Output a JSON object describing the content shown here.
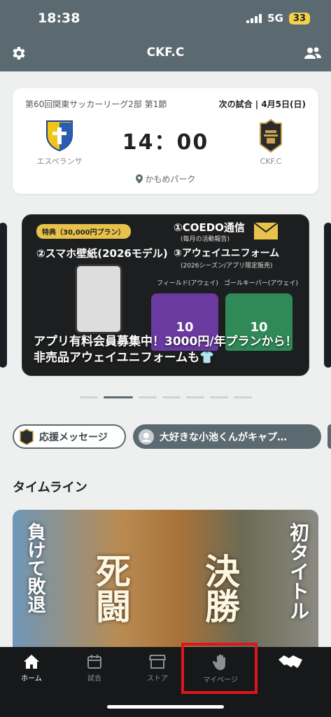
{
  "status_bar": {
    "time": "18:38",
    "network": "5G",
    "battery": "33"
  },
  "header": {
    "title": "CKF.C",
    "left_icon": "gear-icon",
    "right_icon": "people-icon"
  },
  "match": {
    "league": "第60回関東サッカーリーグ2部 第1節",
    "next_match": "次の試合 | 4月5日(日)",
    "home_team": "エスペランサ",
    "away_team": "CKF.C",
    "kickoff": "14：00",
    "venue": "かもめパーク"
  },
  "banner": {
    "tag": "特典（30,000円プラン）",
    "item1": "①COEDO通信",
    "item1_sub": "(毎月の活動報告)",
    "item2": "②スマホ壁紙(2026モデル)",
    "item3": "③アウェイユニフォーム",
    "item3_sub": "(2026シーズン/アプリ限定販売)",
    "field_label": "フィールド(アウェイ)",
    "gk_label": "ゴールキーパー(アウェイ)",
    "shirt_number": "10",
    "caption": "アプリ有料会員募集中！3000円/年プランから！非売品アウェイユニフォームも👕"
  },
  "chips": [
    {
      "label": "応援メッセージ"
    },
    {
      "label": "大好きな小池くんがキャプ…"
    }
  ],
  "timeline": {
    "title": "タイムライン",
    "poster_left": "負けて敗退",
    "poster_mid1": "死闘",
    "poster_mid2": "決勝",
    "poster_right": "初タイトル"
  },
  "nav": [
    {
      "label": "ホーム",
      "icon": "home-icon"
    },
    {
      "label": "試合",
      "icon": "calendar-icon"
    },
    {
      "label": "ストア",
      "icon": "store-icon"
    },
    {
      "label": "マイページ",
      "icon": "hand-icon"
    },
    {
      "label": "",
      "icon": "handshake-icon"
    }
  ],
  "colors": {
    "header": "#5b6a70",
    "nav_bg": "#161819",
    "highlight": "#e0141e"
  }
}
